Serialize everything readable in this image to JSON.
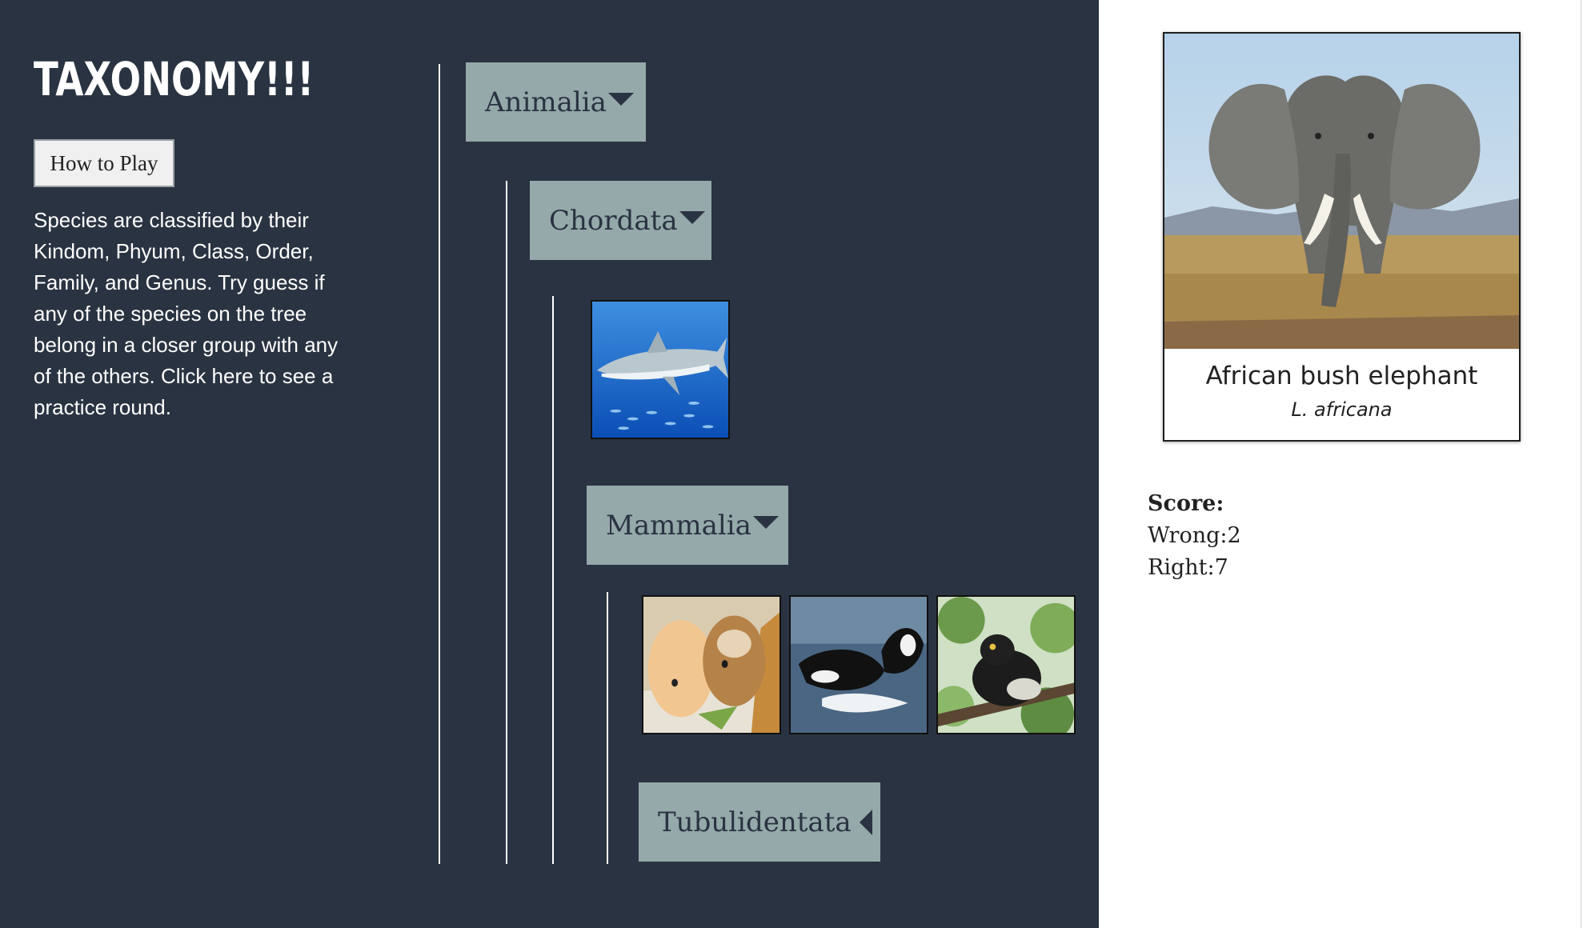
{
  "header": {
    "title": "TAXONOMY!!!"
  },
  "how_to_play_label": "How to Play",
  "instructions": "Species are classified by their Kindom, Phyum, Class, Order, Family, and Genus. Try guess if any of the species on the tree belong in a closer group with any of the others. Click here to see a practice round.",
  "tree": {
    "nodes": [
      {
        "label": "Animalia",
        "expanded": true
      },
      {
        "label": "Chordata",
        "expanded": true
      },
      {
        "label": "Mammalia",
        "expanded": true
      },
      {
        "label": "Tubulidentata",
        "expanded": false
      }
    ],
    "species_thumbnails": [
      {
        "icon": "shark-photo",
        "group": "Chordata"
      },
      {
        "icon": "guinea-pig-photo",
        "group": "Mammalia"
      },
      {
        "icon": "orca-photo",
        "group": "Mammalia"
      },
      {
        "icon": "lemur-photo",
        "group": "Mammalia"
      }
    ]
  },
  "current_species": {
    "common_name": "African bush elephant",
    "scientific_name": "L. africana",
    "icon": "elephant-photo"
  },
  "score": {
    "label": "Score:",
    "wrong": "Wrong:2",
    "right": "Right:7"
  },
  "colors": {
    "panel_background": "#2a3341",
    "node_background": "#95a8aa",
    "line": "#ffffff"
  }
}
